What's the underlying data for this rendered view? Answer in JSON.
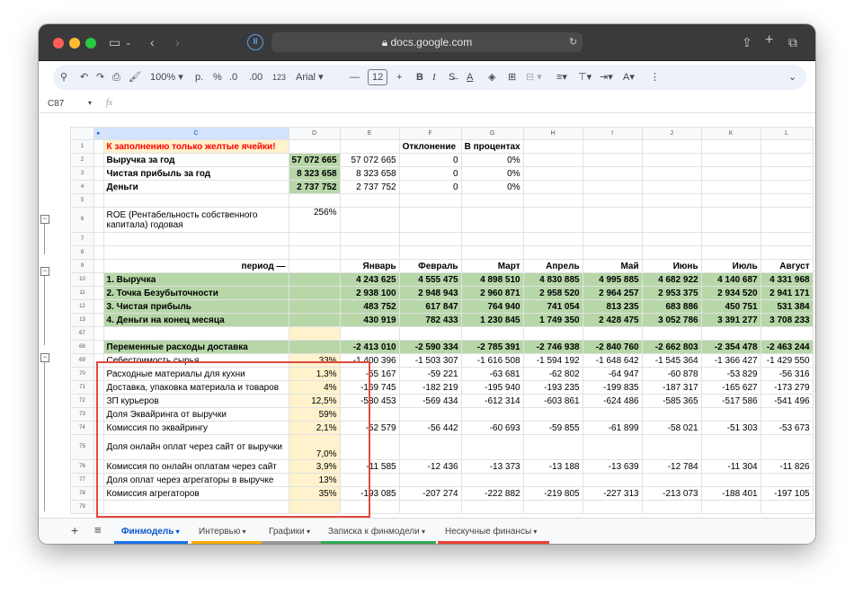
{
  "browser": {
    "url": "docs.google.com"
  },
  "toolbar": {
    "zoom": "100%",
    "ruble": "р.",
    "percent": "%",
    "dec_less": ".0",
    "dec_more": ".00",
    "fmt_123": "123",
    "font": "Arial",
    "font_size": "12",
    "bold": "B",
    "italic": "I"
  },
  "formula_bar": {
    "cell_ref": "C87",
    "fx": "fx"
  },
  "columns": [
    "C",
    "D",
    "E",
    "F",
    "G",
    "H",
    "I",
    "J",
    "K",
    "L"
  ],
  "rows": [
    {
      "n": "1",
      "c": "К заполнению только желтые ячейки!",
      "d": "",
      "v": [
        "",
        "Отклонение",
        "В процентах",
        "",
        "",
        "",
        "",
        ""
      ]
    },
    {
      "n": "2",
      "c": "Выручка за год",
      "d": "57 072 665",
      "v": [
        "57 072 665",
        "0",
        "0%",
        "",
        "",
        "",
        "",
        ""
      ]
    },
    {
      "n": "3",
      "c": "Чистая прибыль за год",
      "d": "8 323 658",
      "v": [
        "8 323 658",
        "0",
        "0%",
        "",
        "",
        "",
        "",
        ""
      ]
    },
    {
      "n": "4",
      "c": "Деньги",
      "d": "2 737 752",
      "v": [
        "2 737 752",
        "0",
        "0%",
        "",
        "",
        "",
        "",
        ""
      ]
    },
    {
      "n": "5",
      "c": "",
      "d": "",
      "v": [
        "",
        "",
        "",
        "",
        "",
        "",
        "",
        ""
      ]
    },
    {
      "n": "6",
      "c": "ROE (Рентабельность собственного капитала) годовая",
      "d": "256%",
      "v": [
        "",
        "",
        "",
        "",
        "",
        "",
        "",
        ""
      ]
    },
    {
      "n": "7",
      "c": "",
      "d": "",
      "v": [
        "",
        "",
        "",
        "",
        "",
        "",
        "",
        ""
      ]
    },
    {
      "n": "8",
      "c": "",
      "d": "",
      "v": [
        "",
        "",
        "",
        "",
        "",
        "",
        "",
        ""
      ]
    },
    {
      "n": "9",
      "c": "период —",
      "d": "",
      "v": [
        "Январь",
        "Февраль",
        "Март",
        "Апрель",
        "Май",
        "Июнь",
        "Июль",
        "Август"
      ]
    },
    {
      "n": "10",
      "c": "1. Выручка",
      "d": "",
      "v": [
        "4 243 625",
        "4 555 475",
        "4 898 510",
        "4 830 885",
        "4 995 885",
        "4 682 922",
        "4 140 687",
        "4 331 968"
      ]
    },
    {
      "n": "11",
      "c": "2. Точка Безубыточности",
      "d": "",
      "v": [
        "2 938 100",
        "2 948 943",
        "2 960 871",
        "2 958 520",
        "2 964 257",
        "2 953 375",
        "2 934 520",
        "2 941 171"
      ]
    },
    {
      "n": "12",
      "c": "3. Чистая прибыль",
      "d": "",
      "v": [
        "483 752",
        "617 847",
        "764 940",
        "741 054",
        "813 235",
        "683 886",
        "450 751",
        "531 384"
      ]
    },
    {
      "n": "13",
      "c": "4. Деньги на конец месяца",
      "d": "",
      "v": [
        "430 919",
        "782 433",
        "1 230 845",
        "1 749 350",
        "2 428 475",
        "3 052 786",
        "3 391 277",
        "3 708 233"
      ]
    },
    {
      "n": "67",
      "c": "",
      "d": "",
      "v": [
        "",
        "",
        "",
        "",
        "",
        "",
        "",
        ""
      ]
    },
    {
      "n": "68",
      "c": "Переменные расходы доставка",
      "d": "",
      "v": [
        "-2 413 010",
        "-2 590 334",
        "-2 785 391",
        "-2 746 938",
        "-2 840 760",
        "-2 662 803",
        "-2 354 478",
        "-2 463 244"
      ]
    },
    {
      "n": "69",
      "c": "Себестоимость сырья",
      "d": "33%",
      "v": [
        "-1 400 396",
        "-1 503 307",
        "-1 616 508",
        "-1 594 192",
        "-1 648 642",
        "-1 545 364",
        "-1 366 427",
        "-1 429 550"
      ]
    },
    {
      "n": "70",
      "c": "Расходные материалы для кухни",
      "d": "1,3%",
      "v": [
        "-55 167",
        "-59 221",
        "-63 681",
        "-62 802",
        "-64 947",
        "-60 878",
        "-53 829",
        "-56 316"
      ]
    },
    {
      "n": "71",
      "c": "Доставка, упаковка материала и товаров",
      "d": "4%",
      "v": [
        "-169 745",
        "-182 219",
        "-195 940",
        "-193 235",
        "-199 835",
        "-187 317",
        "-165 627",
        "-173 279"
      ]
    },
    {
      "n": "72",
      "c": "ЗП курьеров",
      "d": "12,5%",
      "v": [
        "-530 453",
        "-569 434",
        "-612 314",
        "-603 861",
        "-624 486",
        "-585 365",
        "-517 586",
        "-541 496"
      ]
    },
    {
      "n": "73",
      "c": "Доля Эквайринга от выручки",
      "d": "59%",
      "v": [
        "",
        "",
        "",
        "",
        "",
        "",
        "",
        ""
      ]
    },
    {
      "n": "74",
      "c": "Комиссия по эквайрингу",
      "d": "2,1%",
      "v": [
        "-52 579",
        "-56 442",
        "-60 693",
        "-59 855",
        "-61 899",
        "-58 021",
        "-51 303",
        "-53 673"
      ]
    },
    {
      "n": "75",
      "c": "Доля онлайн оплат через сайт от выручки",
      "d": "7,0%",
      "v": [
        "",
        "",
        "",
        "",
        "",
        "",
        "",
        ""
      ]
    },
    {
      "n": "76",
      "c": "Комиссия по онлайн оплатам через сайт",
      "d": "3,9%",
      "v": [
        "-11 585",
        "-12 436",
        "-13 373",
        "-13 188",
        "-13 639",
        "-12 784",
        "-11 304",
        "-11 826"
      ]
    },
    {
      "n": "77",
      "c": "Доля оплат через агрегаторы в выручке",
      "d": "13%",
      "v": [
        "",
        "",
        "",
        "",
        "",
        "",
        "",
        ""
      ]
    },
    {
      "n": "78",
      "c": "Комиссия агрегаторов",
      "d": "35%",
      "v": [
        "-193 085",
        "-207 274",
        "-222 882",
        "-219 805",
        "-227 313",
        "-213 073",
        "-188 401",
        "-197 105"
      ]
    },
    {
      "n": "79",
      "c": "",
      "d": "",
      "v": [
        "",
        "",
        "",
        "",
        "",
        "",
        "",
        ""
      ]
    }
  ],
  "sheet_tabs": [
    {
      "label": "Финмодель",
      "color": "#1a73e8"
    },
    {
      "label": "Интервью",
      "color": "#f9ab00"
    },
    {
      "label": "Графики",
      "color": "#999999"
    },
    {
      "label": "Записка к финмодели",
      "color": "#34a853"
    },
    {
      "label": "Нескучные финансы",
      "color": "#ea4335"
    }
  ]
}
